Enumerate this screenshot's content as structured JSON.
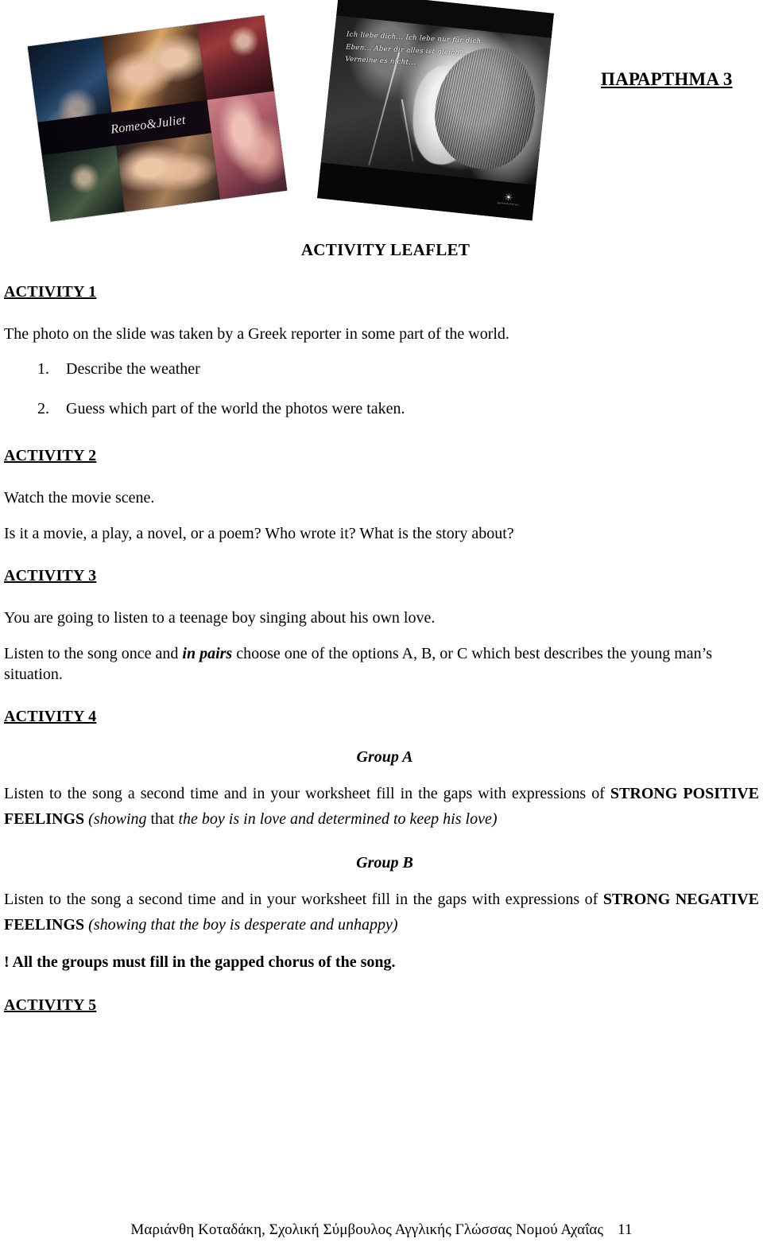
{
  "annex": {
    "title": "ΠΑΡΑΡΤΗΜΑ 3"
  },
  "images": {
    "collage": {
      "name": "romeo-and-juliet-collage",
      "caption_overlay": "Romeo&Juliet"
    },
    "bw_photo": {
      "name": "boy-in-beanie-photo",
      "overlay_text": "Ich liebe dich... Ich lebe nur für dich Eben... Aber dir alles ist gleich?... Verneine es nicht...",
      "watermark_glyph": "☀",
      "watermark_text": "sponsorednews"
    }
  },
  "leaflet": {
    "title": "ACTIVITY LEAFLET"
  },
  "activities": {
    "a1": {
      "heading": "ACTIVITY 1",
      "intro": "The photo on the slide was taken by a Greek reporter in some part of the world.",
      "questions": [
        "Describe the weather",
        "Guess which part of the world the photos were taken."
      ]
    },
    "a2": {
      "heading": "ACTIVITY 2",
      "line1": "Watch the movie scene.",
      "line2": "Is it a movie, a play, a novel, or a poem? Who wrote it? What is the story about?"
    },
    "a3": {
      "heading": "ACTIVITY 3",
      "line1": "You are going to listen to a teenage boy singing about his own love.",
      "line2_part1": "Listen to the song once and ",
      "line2_emph": "in pairs",
      "line2_part2": " choose one of the options A, B, or C which best describes the young man’s situation."
    },
    "a4": {
      "heading": "ACTIVITY 4",
      "group_a": {
        "label": "Group A",
        "lead": "Listen to the song a second time and in your worksheet fill in the gaps with expressions of ",
        "emphasis": "STRONG POSITIVE FEELINGS",
        "paren_open": " (showing",
        "paren_mid": " that ",
        "paren_rest": "the boy is in love and determined to keep his love)"
      },
      "group_b": {
        "label": "Group B",
        "lead": "Listen to the song a second time and in your worksheet fill in the gaps with expressions of ",
        "emphasis": "STRONG NEGATIVE FEELINGS",
        "paren": " (showing that the boy is desperate and unhappy)"
      },
      "note": "! All the groups must fill in the gapped chorus of the song."
    },
    "a5": {
      "heading": "ACTIVITY 5"
    }
  },
  "footer": {
    "text": "Μαριάνθη Κοταδάκη, Σχολική Σύμβουλος Αγγλικής Γλώσσας Νομού Αχαΐας",
    "page_number": "11"
  }
}
